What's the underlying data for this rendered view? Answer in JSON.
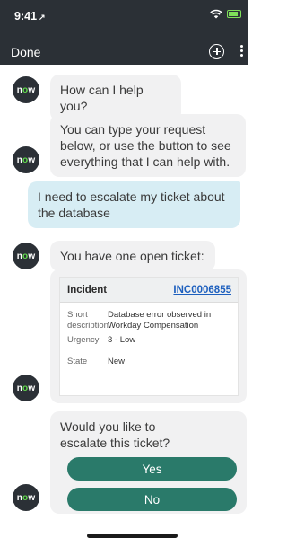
{
  "status_bar": {
    "time": "9:41",
    "location_glyph": "↗"
  },
  "nav": {
    "done_label": "Done",
    "add_icon": "plus-circle-icon",
    "more_icon": "more-vertical-icon"
  },
  "avatar": {
    "prefix": "n",
    "o": "o",
    "suffix": "w"
  },
  "messages": {
    "m1": "How can I help you?",
    "m2": "You can type your request below, or use the button to see everything that I can help with.",
    "m3": "I need to escalate my ticket about the database",
    "m4": "You have one open ticket:",
    "m5": "Would you like to escalate this ticket?"
  },
  "ticket": {
    "type": "Incident",
    "number": "INC0006855",
    "short_description_label": "Short description",
    "short_description": "Database error observed in Workday Compensation",
    "urgency_label": "Urgency",
    "urgency": "3 - Low",
    "state_label": "State",
    "state": "New"
  },
  "buttons": {
    "yes": "Yes",
    "no": "No"
  },
  "colors": {
    "header": "#2b3036",
    "bot_bubble": "#f1f1f2",
    "user_bubble": "#d7edf4",
    "button": "#2a7a6a",
    "link": "#1c5fbe",
    "brand_o": "#62d84e"
  }
}
